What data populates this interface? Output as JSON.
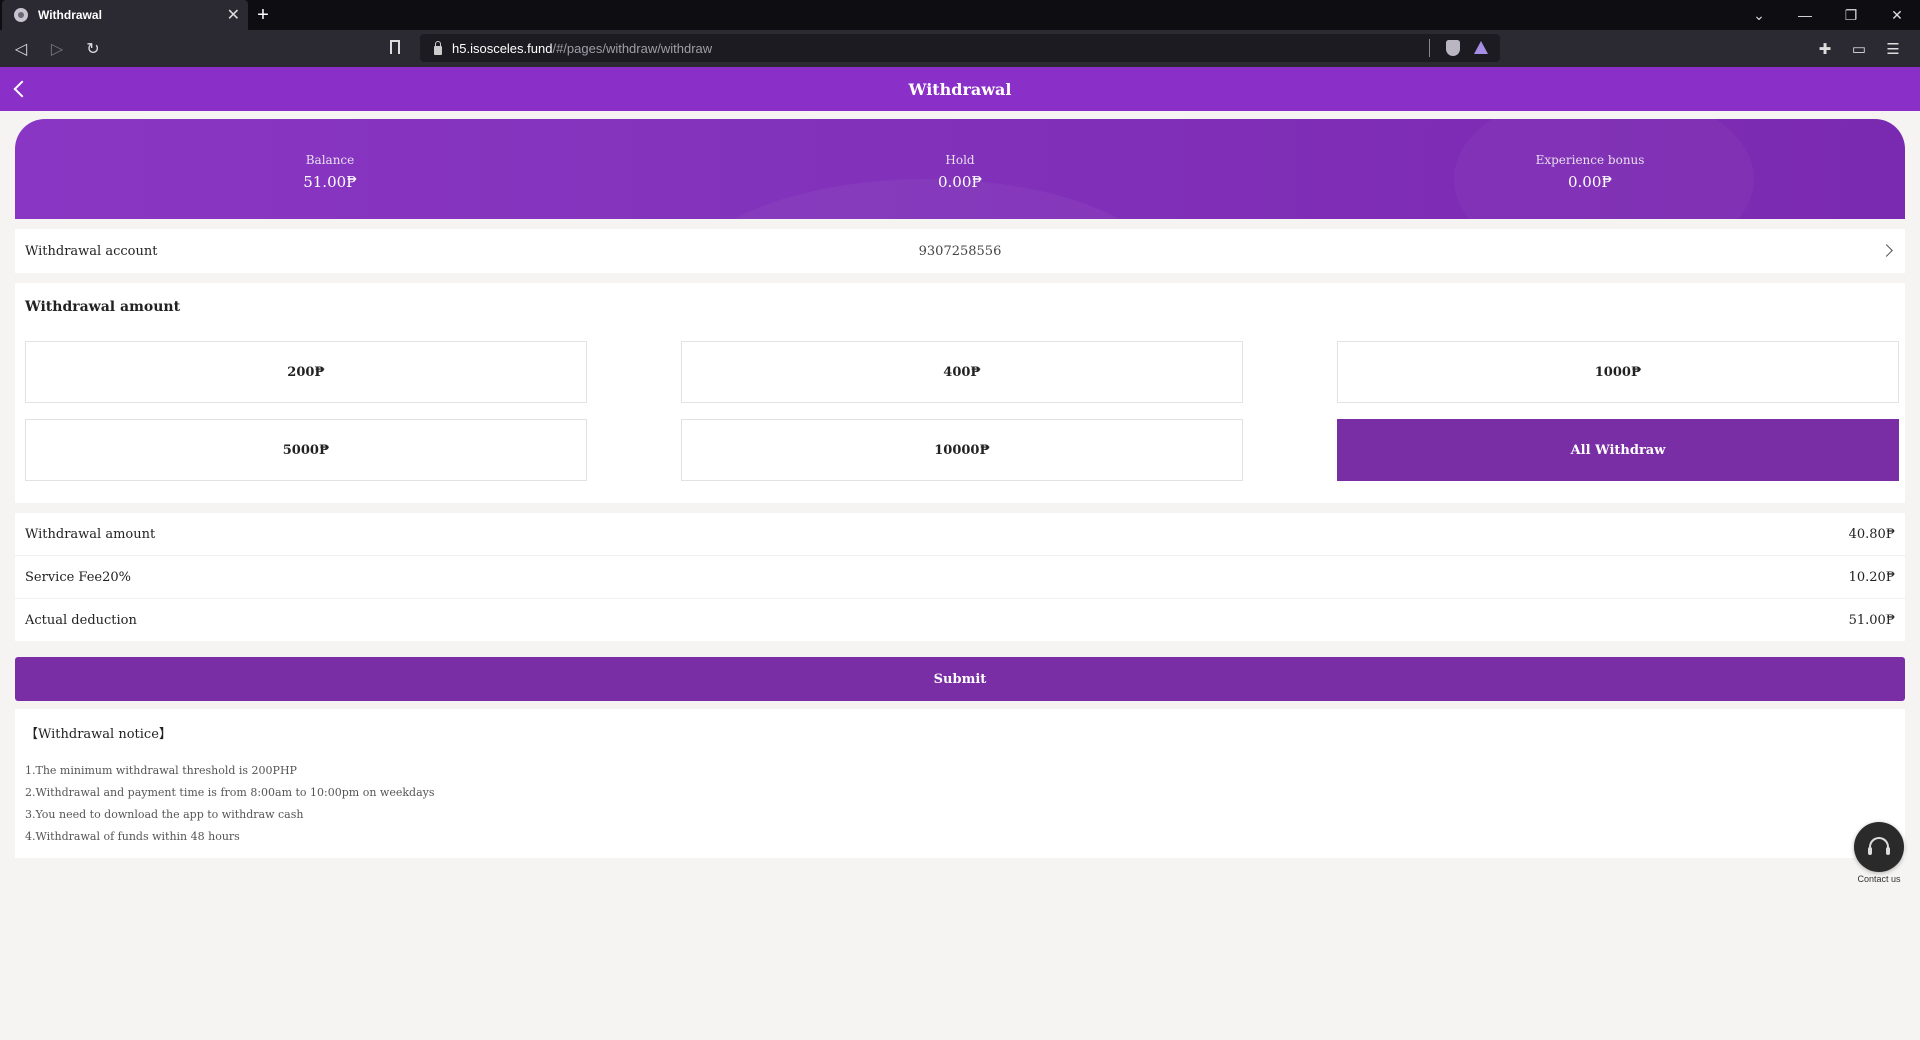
{
  "browser": {
    "tab_title": "Withdrawal",
    "tab_close": "✕",
    "new_tab": "+",
    "url_host": "h5.isosceles.fund",
    "url_path": "/#/pages/withdraw/withdraw",
    "window_controls": [
      "⌄",
      "—",
      "❐",
      "✕"
    ]
  },
  "header": {
    "title": "Withdrawal"
  },
  "balance": {
    "items": [
      {
        "label": "Balance",
        "value": "51.00₱"
      },
      {
        "label": "Hold",
        "value": "0.00₱"
      },
      {
        "label": "Experience bonus",
        "value": "0.00₱"
      }
    ]
  },
  "account": {
    "label": "Withdrawal account",
    "value": "9307258556"
  },
  "amount_section": {
    "title": "Withdrawal amount",
    "options": [
      "200₱",
      "400₱",
      "1000₱",
      "5000₱",
      "10000₱",
      "All Withdraw"
    ],
    "selected": "All Withdraw"
  },
  "calc": {
    "rows": [
      {
        "label": "Withdrawal amount",
        "value": "40.80₱"
      },
      {
        "label": "Service Fee20%",
        "value": "10.20₱"
      },
      {
        "label": "Actual deduction",
        "value": "51.00₱"
      }
    ]
  },
  "submit_label": "Submit",
  "notice": {
    "title": "【Withdrawal notice】",
    "items": [
      "1.The minimum withdrawal threshold is 200PHP",
      "2.Withdrawal and payment time is from 8:00am to 10:00pm on weekdays",
      "3.You need to download the app to withdraw cash",
      "4.Withdrawal of funds within 48 hours"
    ]
  },
  "contact_label": "Contact us",
  "colors": {
    "brand": "#8a2fc7",
    "button": "#7a2ea6"
  }
}
